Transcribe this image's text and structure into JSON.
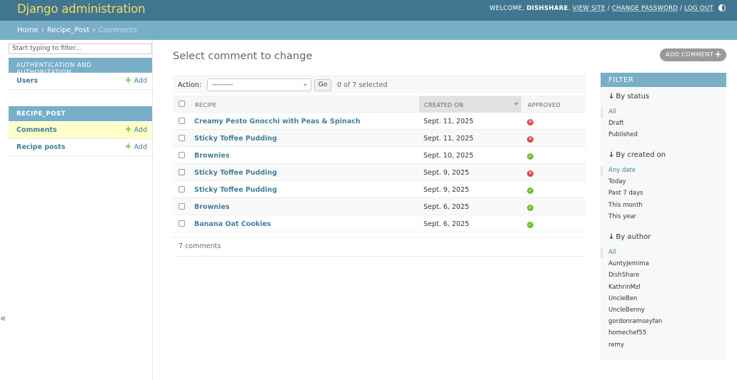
{
  "header": {
    "branding": "Django administration",
    "welcome": "Welcome,",
    "username": "DishShare",
    "links": [
      "View site",
      "Change password",
      "Log out"
    ]
  },
  "breadcrumbs": [
    "Home",
    "Recipe_Post",
    "Comments"
  ],
  "sidebar": {
    "filter_placeholder": "Start typing to filter...",
    "modules": [
      {
        "caption": "Authentication and Authorization",
        "models": [
          {
            "name": "Users",
            "add": "Add"
          }
        ]
      },
      {
        "caption": "RECIPE_POST",
        "models": [
          {
            "name": "Comments",
            "add": "Add"
          },
          {
            "name": "Recipe posts",
            "add": "Add"
          }
        ]
      }
    ],
    "collapse_label": "«"
  },
  "content": {
    "title": "Select comment to change",
    "add_button": "Add comment",
    "actions": {
      "label": "Action:",
      "selected_option": "---------",
      "go": "Go",
      "counter": "0 of 7 selected"
    },
    "columns": [
      "Recipe",
      "Created on",
      "Approved"
    ],
    "rows": [
      {
        "recipe": "Creamy Pesto Gnocchi with Peas & Spinach",
        "created": "Sept. 11, 2025",
        "approved": false
      },
      {
        "recipe": "Sticky Toffee Pudding",
        "created": "Sept. 11, 2025",
        "approved": false
      },
      {
        "recipe": "Brownies",
        "created": "Sept. 10, 2025",
        "approved": true
      },
      {
        "recipe": "Sticky Toffee Pudding",
        "created": "Sept. 9, 2025",
        "approved": false
      },
      {
        "recipe": "Sticky Toffee Pudding",
        "created": "Sept. 9, 2025",
        "approved": true
      },
      {
        "recipe": "Brownies",
        "created": "Sept. 6, 2025",
        "approved": true
      },
      {
        "recipe": "Banana Oat Cookies",
        "created": "Sept. 6, 2025",
        "approved": true
      }
    ],
    "paginator": "7 comments"
  },
  "filter": {
    "caption": "Filter",
    "groups": [
      {
        "heading": "By status",
        "options": [
          "All",
          "Draft",
          "Published"
        ],
        "selected": 0
      },
      {
        "heading": "By created on",
        "options": [
          "Any date",
          "Today",
          "Past 7 days",
          "This month",
          "This year"
        ],
        "selected": 0
      },
      {
        "heading": "By author",
        "options": [
          "All",
          "AuntyJemima",
          "DishShare",
          "KathrinMzl",
          "UncleBen",
          "UncleBenny",
          "gordonramseyfan",
          "homechef55",
          "remy"
        ],
        "selected": 0
      }
    ]
  },
  "colors": {
    "header_bg": "#417690",
    "branding": "#f5dd5d",
    "breadcrumbs_bg": "#79aec8",
    "link": "#447e9b",
    "add_green": "#70bf2b",
    "reject_red": "#dd4646",
    "current_row": "#ffffcc"
  }
}
